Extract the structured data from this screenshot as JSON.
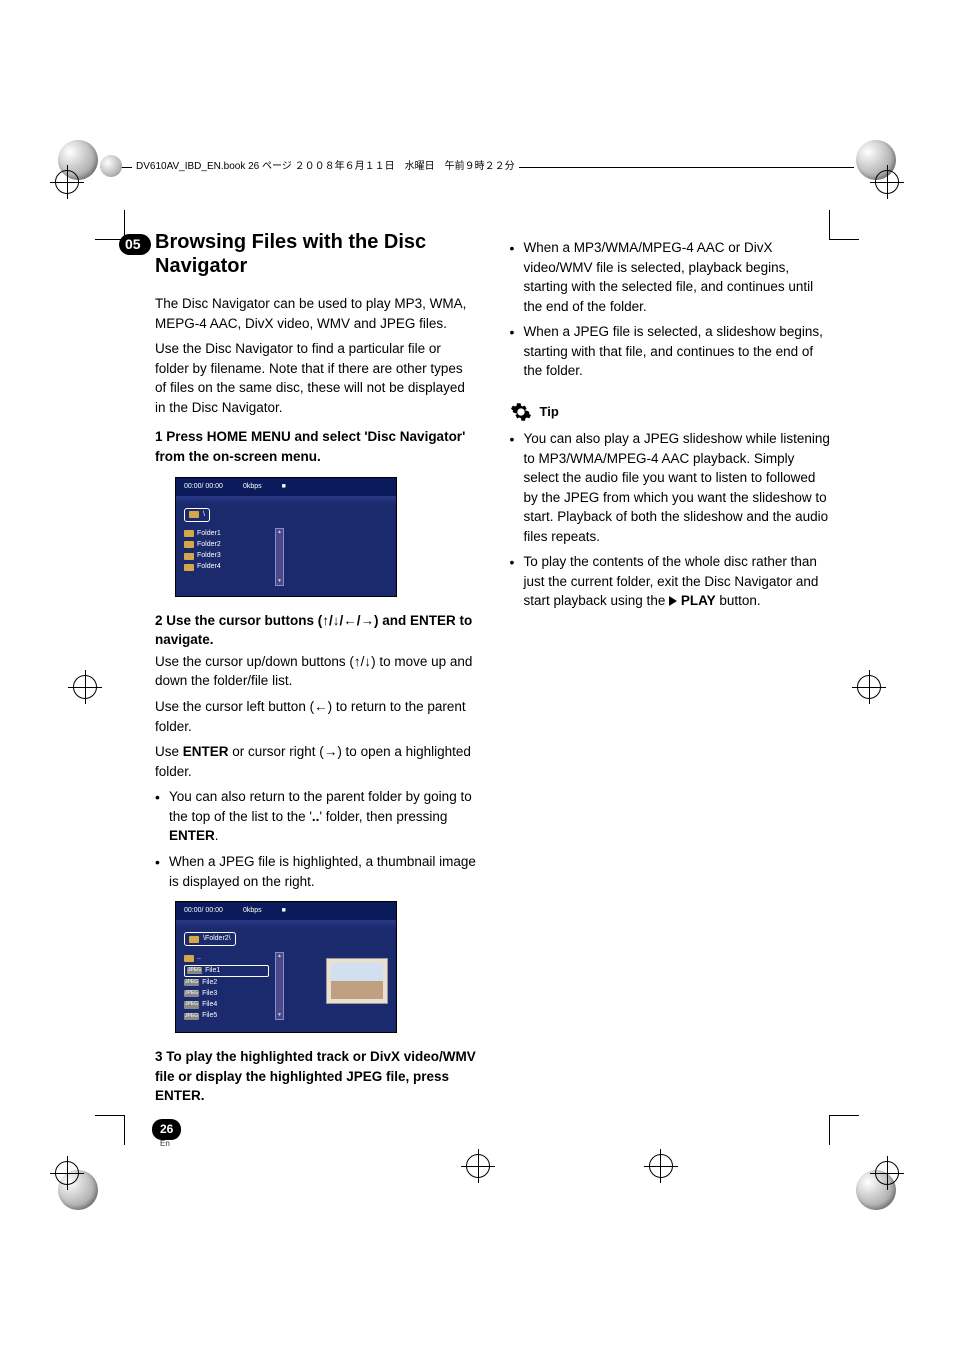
{
  "chapter_number": "05",
  "header_text": "DV610AV_IBD_EN.book  26 ページ  ２００８年６月１１日　水曜日　午前９時２２分",
  "title": "Browsing Files with the Disc Navigator",
  "intro_p1": "The Disc Navigator can be used to play MP3, WMA, MEPG-4 AAC, DivX video, WMV and JPEG files.",
  "intro_p2": "Use the Disc Navigator to find a particular file or folder by filename. Note that if there are other types of files on the same disc, these will not be displayed in the Disc Navigator.",
  "step1_title": "1    Press HOME MENU and select 'Disc Navigator' from the on-screen menu.",
  "step2_title": "2    Use the cursor buttons (↑/↓/←/→) and ENTER to navigate.",
  "step2_p1_pre": "Use the cursor up/down buttons (",
  "step2_p1_post": ") to move up and down the folder/file list.",
  "step2_p2_pre": "Use the cursor left button (",
  "step2_p2_post": ") to return to the parent folder.",
  "step2_p3_pre": "Use ",
  "step2_p3_enter": "ENTER",
  "step2_p3_mid": " or cursor right (",
  "step2_p3_post": ") to open a highlighted folder.",
  "step2_bullet1_pre": "You can also return to the parent folder by going to the top of the list to the '",
  "step2_bullet1_dots": "..",
  "step2_bullet1_mid": "' folder, then pressing ",
  "step2_bullet1_enter": "ENTER",
  "step2_bullet1_post": ".",
  "step2_bullet2": "When a JPEG file is highlighted, a thumbnail image is displayed on the right.",
  "step3_title": "3    To play the highlighted track or DivX video/WMV file or display the highlighted JPEG file, press ENTER.",
  "right_bullet1": "When a MP3/WMA/MPEG-4 AAC or DivX video/WMV file is selected, playback begins, starting with the selected file, and continues until the end of the folder.",
  "right_bullet2": "When a JPEG file is selected, a slideshow begins, starting with that file, and continues to the end of the folder.",
  "tip_label": "Tip",
  "tip_bullet1": "You can also play a JPEG slideshow while listening to MP3/WMA/MPEG-4 AAC playback. Simply select the audio file you want to listen to followed by the JPEG from which you want the slideshow to start. Playback of both the slideshow and the audio files repeats.",
  "tip_bullet2_pre": "To play the contents of the whole disc rather than just the current folder, exit the Disc Navigator and start playback using the ",
  "tip_bullet2_play": "PLAY",
  "tip_bullet2_post": " button.",
  "page_number": "26",
  "page_lang": "En",
  "screenshot1": {
    "time": "00:00/ 00:00",
    "bitrate": "0kbps",
    "stop": "■",
    "path": "\\",
    "folders": [
      "Folder1",
      "Folder2",
      "Folder3",
      "Folder4"
    ]
  },
  "screenshot2": {
    "time": "00:00/ 00:00",
    "bitrate": "0kbps",
    "stop": "■",
    "path": "\\Folder2\\",
    "parent": "..",
    "chip": "JPEG",
    "files": [
      "File1",
      "File2",
      "File3",
      "File4",
      "File5"
    ]
  }
}
